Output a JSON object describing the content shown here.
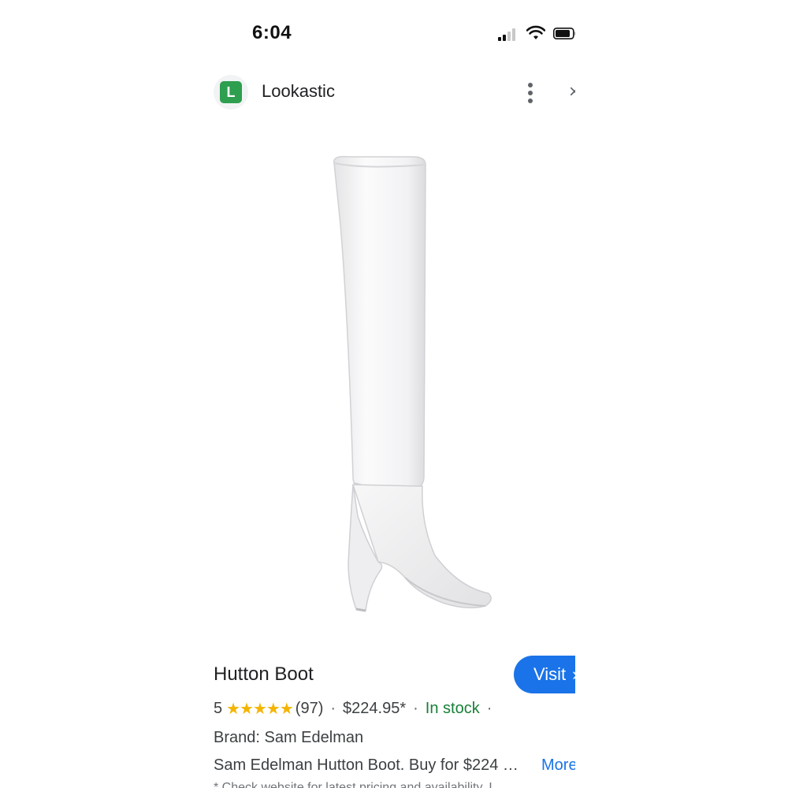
{
  "status_bar": {
    "time": "6:04",
    "signal_icon": "cellular-signal-icon",
    "wifi_icon": "wifi-icon",
    "battery_icon": "battery-icon"
  },
  "header": {
    "logo_letter": "L",
    "site_name": "Lookastic",
    "menu_icon": "more-vertical-icon",
    "close_icon": "close-icon"
  },
  "product": {
    "image_icon": "white-knee-high-boot-image",
    "title": "Hutton Boot",
    "visit_label": "Visit",
    "rating_value": "5",
    "stars": "★★★★★",
    "review_count": "(97)",
    "price": "$224.95*",
    "availability": "In stock",
    "brand": "Brand: Sam Edelman",
    "description": "Sam Edelman Hutton Boot. Buy for $224 …",
    "more_label": "More",
    "footnote": "* Check website for latest pricing and availability. I"
  },
  "colors": {
    "accent": "#1a73e8",
    "in_stock": "#188038",
    "star": "#f4b400",
    "logo_bg": "#2e9e4f"
  }
}
